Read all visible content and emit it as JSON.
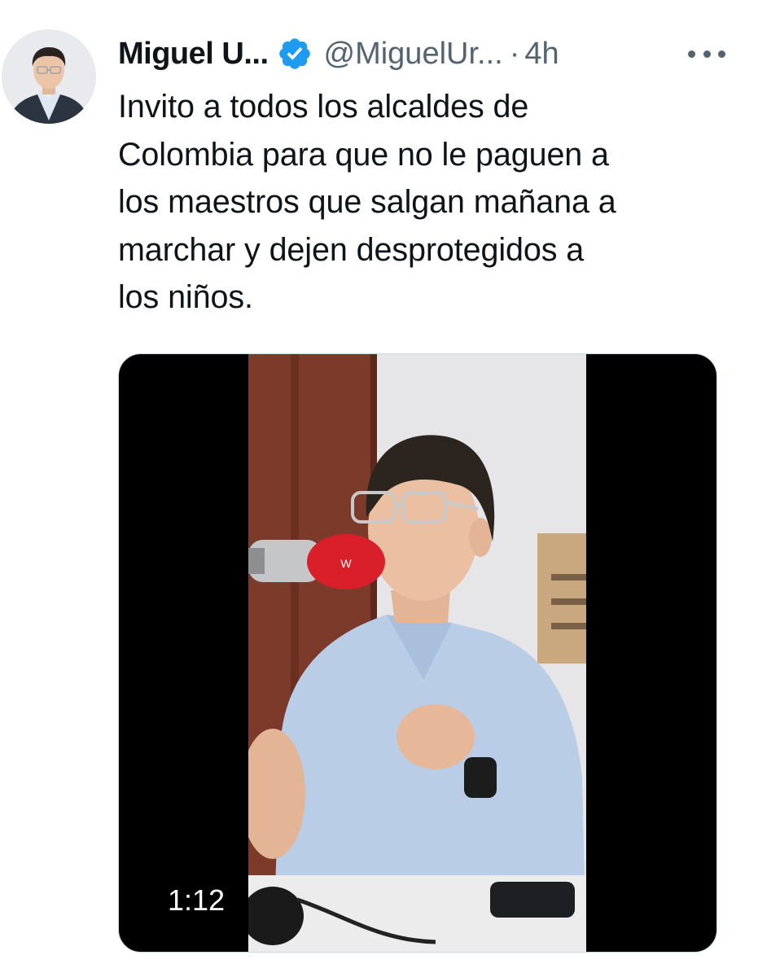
{
  "tweet": {
    "author_name": "Miguel U...",
    "handle": "@MiguelUr...",
    "separator": "·",
    "time": "4h",
    "verified": true,
    "text": "Invito a todos los alcaldes de Colombia para que no le paguen a los maestros que salgan mañana a marchar y dejen desprotegidos a los niños.",
    "text_lines": [
      "Invito a todos los alcaldes de",
      "Colombia para que no le paguen a",
      "los maestros que salgan mañana a",
      "marchar y dejen desprotegidos a",
      "los niños."
    ]
  },
  "media": {
    "type": "video",
    "duration": "1:12"
  },
  "icons": {
    "verified": "verified-badge-icon",
    "more": "more-options-icon"
  },
  "colors": {
    "verified_blue": "#1d9bf0",
    "text_primary": "#0f1419",
    "text_secondary": "#536471",
    "mic_red": "#d81f2a"
  }
}
